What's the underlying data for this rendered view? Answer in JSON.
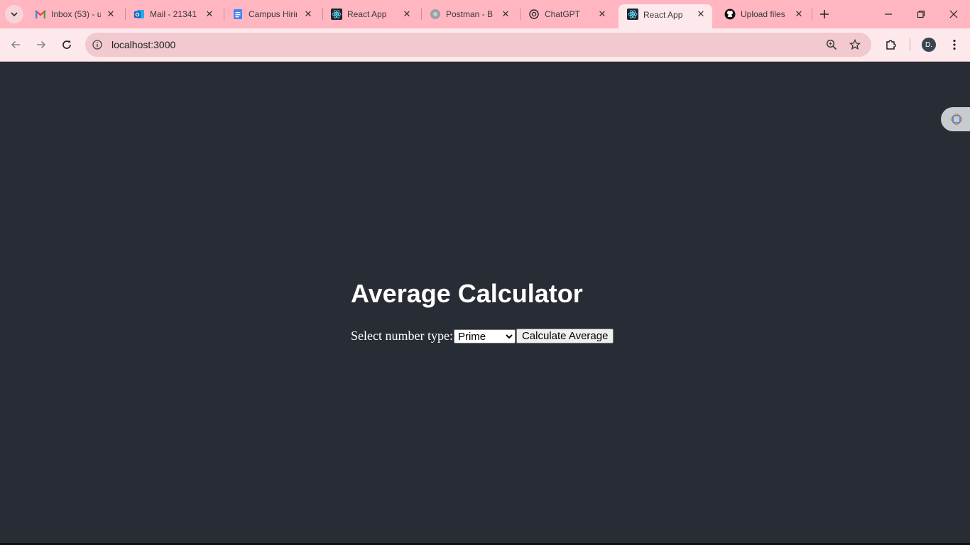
{
  "browser": {
    "tabs": [
      {
        "title": "Inbox (53) - u",
        "icon": "gmail-icon",
        "color": "#ea4335"
      },
      {
        "title": "Mail - 21341",
        "icon": "outlook-icon",
        "color": "#0a64b8"
      },
      {
        "title": "Campus Hirin",
        "icon": "docs-icon",
        "color": "#4285f4"
      },
      {
        "title": "React App",
        "icon": "react-icon",
        "color": "#61dafb"
      },
      {
        "title": "Postman - Br",
        "icon": "globe-icon",
        "color": "#9aa0a6"
      },
      {
        "title": "ChatGPT",
        "icon": "chatgpt-icon",
        "color": "#222222"
      },
      {
        "title": "React App",
        "icon": "react-icon",
        "color": "#61dafb",
        "active": true
      },
      {
        "title": "Upload files",
        "icon": "github-icon",
        "color": "#111111"
      }
    ],
    "address": "localhost:3000",
    "profile_initial": "D."
  },
  "app": {
    "heading": "Average Calculator",
    "select_label": "Select number type:",
    "select_value": "Prime",
    "select_options": [
      "Prime"
    ],
    "button_label": "Calculate Average"
  },
  "colors": {
    "page_bg": "#282c34",
    "tabstrip_bg": "#ffb6c1",
    "toolbar_bg": "#fde9ec"
  }
}
